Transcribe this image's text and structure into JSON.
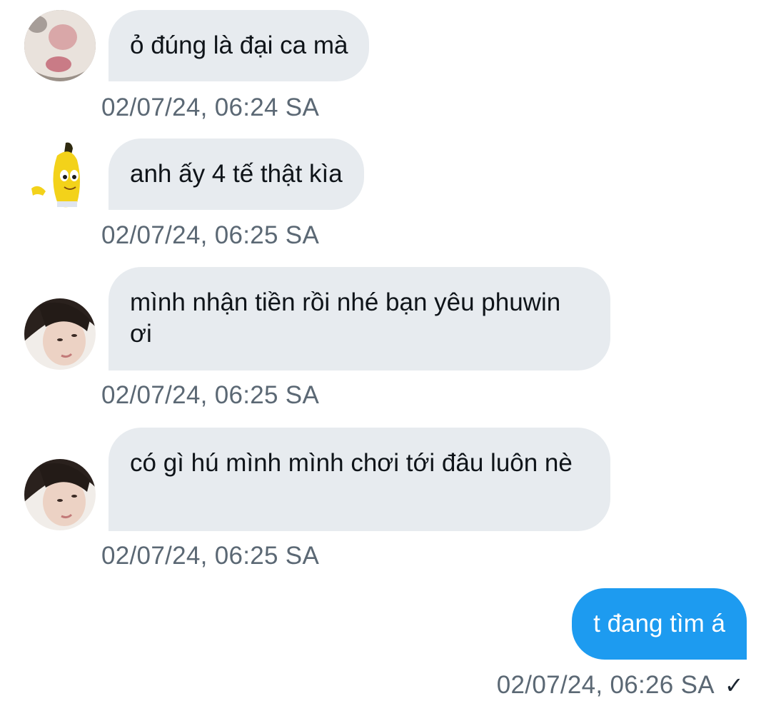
{
  "colors": {
    "incoming_bubble": "#e7ebef",
    "outgoing_bubble": "#1d9bf0",
    "timestamp": "#5b6874"
  },
  "messages": [
    {
      "avatar_icon": "cat-avatar-icon",
      "text": "ỏ đúng là đại ca mà",
      "time": "02/07/24, 06:24 SA"
    },
    {
      "avatar_icon": "banana-avatar-icon",
      "text": "anh ấy 4 tế thật kìa",
      "time": "02/07/24, 06:25 SA"
    },
    {
      "avatar_icon": "person-avatar-icon",
      "text": "mình nhận tiền rồi nhé bạn yêu phuwin ơi",
      "time": "02/07/24, 06:25 SA"
    },
    {
      "avatar_icon": "person-avatar-icon",
      "text": "có gì hú mình mình chơi tới đâu luôn nè",
      "time": "02/07/24, 06:25 SA"
    }
  ],
  "outgoing": {
    "text": "t đang tìm á",
    "time": "02/07/24, 06:26 SA",
    "status_icon": "check-icon",
    "status_glyph": "✓"
  }
}
